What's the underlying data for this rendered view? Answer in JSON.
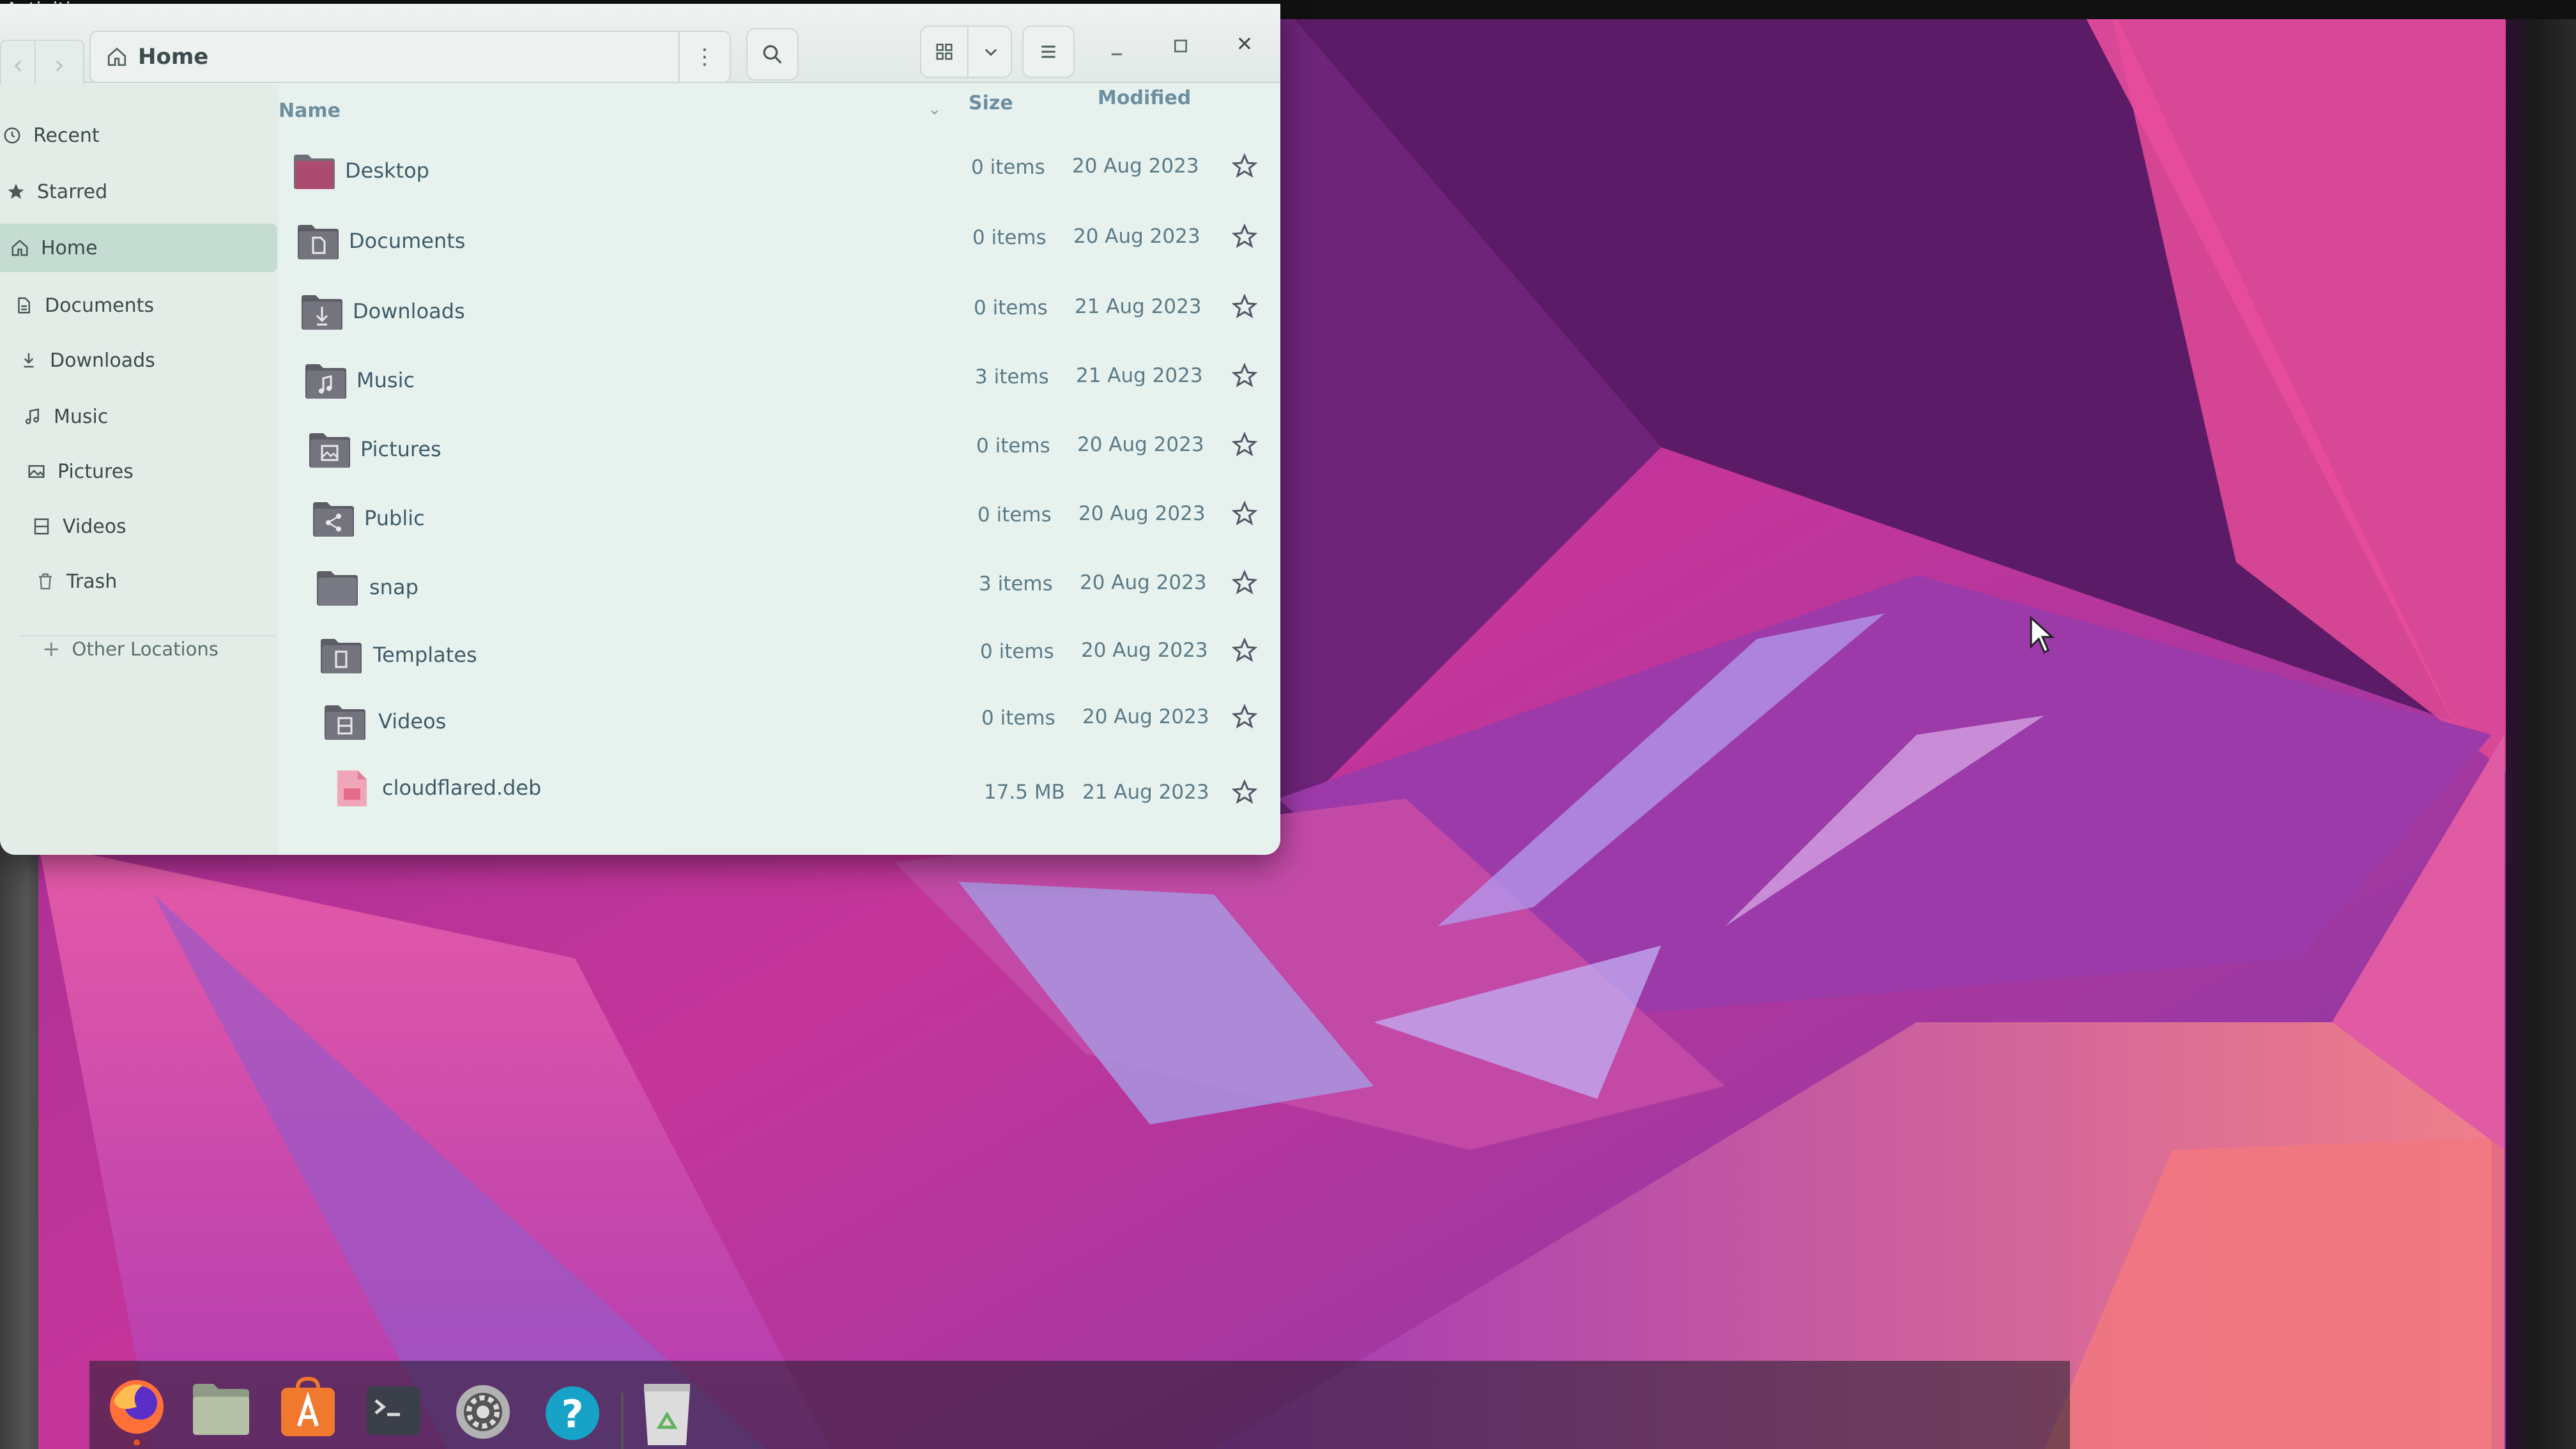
{
  "topbar": {
    "activities_label": "Activities"
  },
  "window": {
    "location_label": "Home",
    "sidebar": {
      "items": [
        {
          "label": "Recent",
          "icon": "clock-icon"
        },
        {
          "label": "Starred",
          "icon": "star-icon"
        },
        {
          "label": "Home",
          "icon": "home-icon",
          "active": true
        },
        {
          "label": "Documents",
          "icon": "document-icon"
        },
        {
          "label": "Downloads",
          "icon": "download-icon"
        },
        {
          "label": "Music",
          "icon": "music-note-icon"
        },
        {
          "label": "Pictures",
          "icon": "image-icon"
        },
        {
          "label": "Videos",
          "icon": "film-icon"
        },
        {
          "label": "Trash",
          "icon": "trash-icon"
        }
      ],
      "other_locations_label": "Other Locations"
    },
    "columns": {
      "name": "Name",
      "size": "Size",
      "modified": "Modified"
    },
    "files": [
      {
        "name": "Desktop",
        "size": "0 items",
        "modified": "20 Aug 2023",
        "icon": "desktop-folder-icon"
      },
      {
        "name": "Documents",
        "size": "0 items",
        "modified": "20 Aug 2023",
        "icon": "documents-folder-icon"
      },
      {
        "name": "Downloads",
        "size": "0 items",
        "modified": "21 Aug 2023",
        "icon": "downloads-folder-icon"
      },
      {
        "name": "Music",
        "size": "3 items",
        "modified": "21 Aug 2023",
        "icon": "music-folder-icon"
      },
      {
        "name": "Pictures",
        "size": "0 items",
        "modified": "20 Aug 2023",
        "icon": "pictures-folder-icon"
      },
      {
        "name": "Public",
        "size": "0 items",
        "modified": "20 Aug 2023",
        "icon": "public-folder-icon"
      },
      {
        "name": "snap",
        "size": "3 items",
        "modified": "20 Aug 2023",
        "icon": "folder-icon"
      },
      {
        "name": "Templates",
        "size": "0 items",
        "modified": "20 Aug 2023",
        "icon": "templates-folder-icon"
      },
      {
        "name": "Videos",
        "size": "0 items",
        "modified": "20 Aug 2023",
        "icon": "videos-folder-icon"
      },
      {
        "name": "cloudflared.deb",
        "size": "17.5 MB",
        "modified": "21 Aug 2023",
        "icon": "deb-package-icon"
      }
    ]
  },
  "dock": {
    "apps": [
      "firefox-icon",
      "files-icon",
      "app-center-icon",
      "terminal-icon",
      "settings-icon",
      "help-icon",
      "trash-recycle-icon"
    ]
  },
  "colors": {
    "accent": "#e95420",
    "folder": "#6f6f78",
    "selection": "#c5dcd2",
    "link_text": "#3f5b68"
  }
}
